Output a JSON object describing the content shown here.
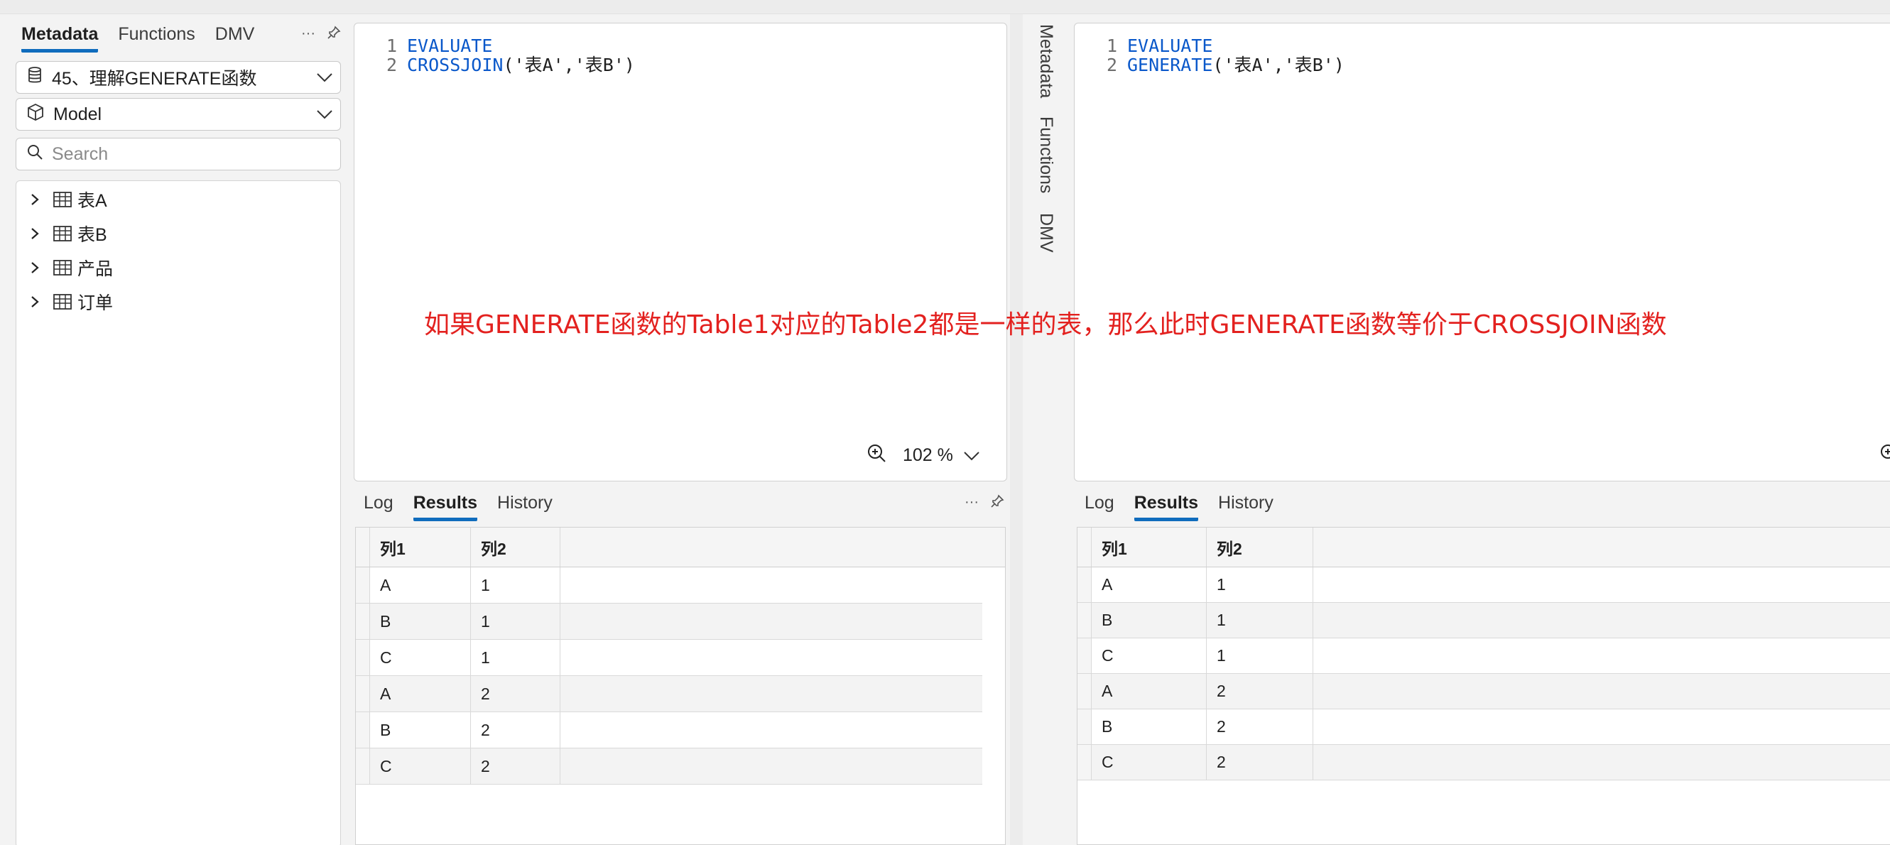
{
  "left_pane": {
    "tabs": [
      "Metadata",
      "Functions",
      "DMV"
    ],
    "active_tab": "Metadata",
    "database": "45、理解GENERATE函数",
    "model": "Model",
    "search_placeholder": "Search",
    "tables": [
      "表A",
      "表B",
      "产品",
      "订单"
    ]
  },
  "left_editor": {
    "lines": [
      {
        "num": "1",
        "text": "EVALUATE"
      },
      {
        "num": "2",
        "func": "CROSSJOIN",
        "args": "('表A','表B')"
      }
    ],
    "zoom": "102 %"
  },
  "right_editor": {
    "lines": [
      {
        "num": "1",
        "text": "EVALUATE"
      },
      {
        "num": "2",
        "func": "GENERATE",
        "args": "('表A','表B')"
      }
    ]
  },
  "vertical_tabs": [
    "Metadata",
    "Functions",
    "DMV"
  ],
  "results_tabs": [
    "Log",
    "Results",
    "History"
  ],
  "results_active": "Results",
  "results": {
    "columns": [
      "列1",
      "列2"
    ],
    "rows": [
      [
        "A",
        "1"
      ],
      [
        "B",
        "1"
      ],
      [
        "C",
        "1"
      ],
      [
        "A",
        "2"
      ],
      [
        "B",
        "2"
      ],
      [
        "C",
        "2"
      ]
    ]
  },
  "annotation": "如果GENERATE函数的Table1对应的Table2都是一样的表，那么此时GENERATE函数等价于CROSSJOIN函数",
  "colors": {
    "accent": "#0f6cbd",
    "keyword": "#0a58ca",
    "annotation": "#e3211f"
  },
  "icons": {
    "database": "database-icon",
    "model": "cube-icon",
    "search": "search-icon",
    "table": "table-icon",
    "zoom": "zoom-in-icon",
    "pin": "pin-icon",
    "more": "more-icon",
    "chevron": "chevron-down-icon",
    "expand": "chevron-right-icon"
  }
}
